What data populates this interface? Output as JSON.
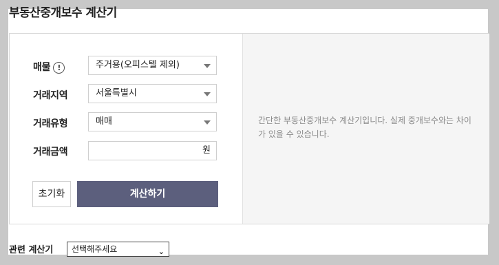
{
  "title": "부동산중개보수 계산기",
  "form": {
    "property_label": "매물",
    "property_info_glyph": "!",
    "property_value": "주거용(오피스텔 제외)",
    "region_label": "거래지역",
    "region_value": "서울특별시",
    "type_label": "거래유형",
    "type_value": "매매",
    "amount_label": "거래금액",
    "amount_value": "",
    "amount_unit": "원",
    "reset_label": "초기화",
    "calc_label": "계산하기"
  },
  "info": {
    "text": "간단한 부동산중개보수 계산기입니다. 실제 중개보수와는 차이가 있을 수 있습니다."
  },
  "related": {
    "label": "관련 계산기",
    "select_value": "선택해주세요",
    "chevron_glyph": "⌄"
  },
  "colors": {
    "calc_button": "#5c5f7d",
    "background": "#c8c8c8",
    "info_panel": "#f5f5f5"
  },
  "icons": [
    "info-icon",
    "caret-down-icon",
    "chevron-down-icon"
  ]
}
